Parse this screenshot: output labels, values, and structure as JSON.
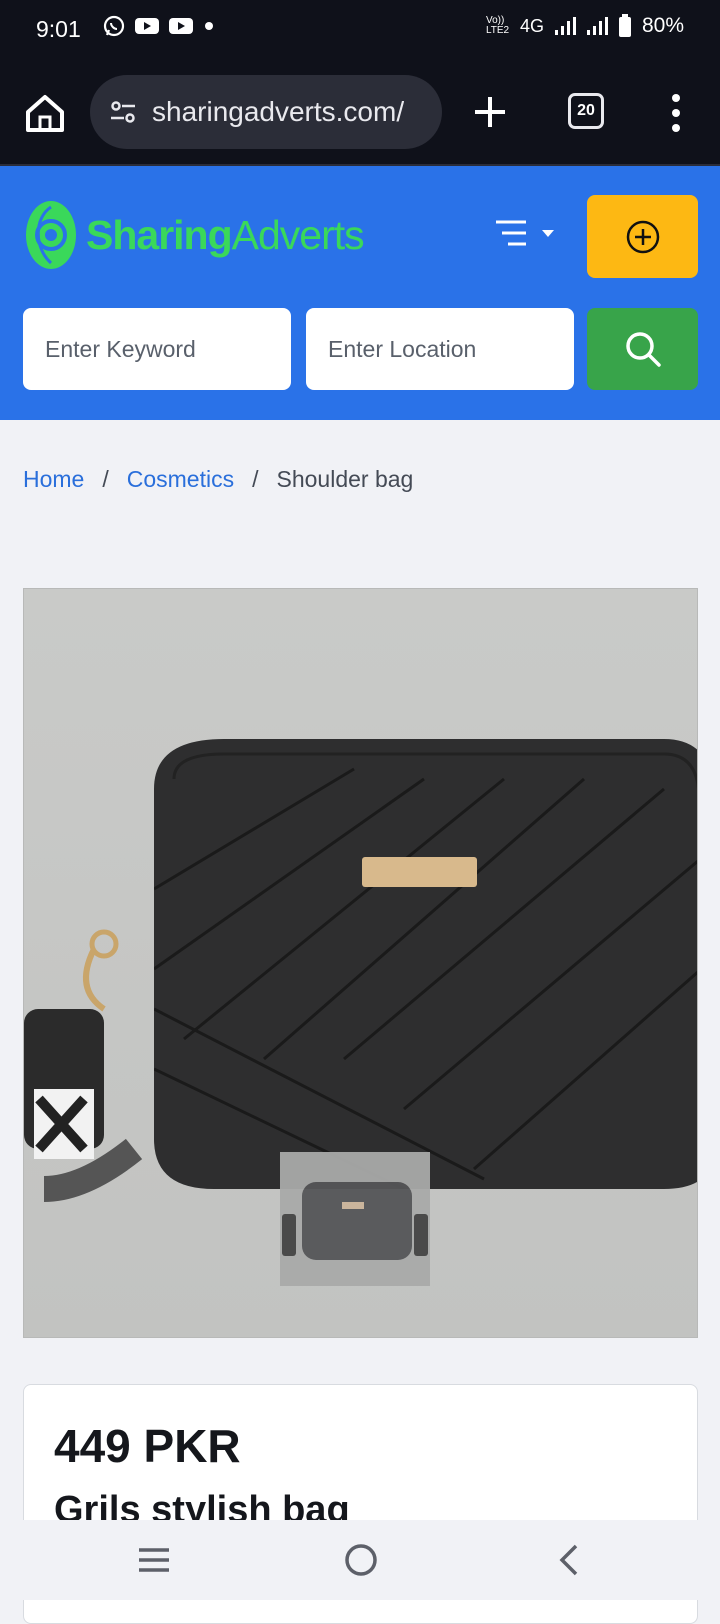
{
  "status_bar": {
    "time": "9:01",
    "network": "4G",
    "volte": "Vo)) LTE2",
    "battery": "80%",
    "notification_icons": [
      "whatsapp-icon",
      "youtube-icon",
      "youtube-icon",
      "dot-icon"
    ]
  },
  "browser": {
    "url": "sharingadverts.com/",
    "tab_count": "20"
  },
  "site": {
    "logo_bold": "Sharing",
    "logo_light": "Adverts",
    "brand_color": "#2a72e8",
    "accent_yellow": "#fdb813",
    "accent_green": "#38a44a"
  },
  "search": {
    "keyword_placeholder": "Enter Keyword",
    "location_placeholder": "Enter Location"
  },
  "breadcrumb": {
    "home": "Home",
    "category": "Cosmetics",
    "current": "Shoulder bag",
    "separator": "/"
  },
  "product": {
    "price": "449 PKR",
    "title": "Grils stylish bag"
  }
}
